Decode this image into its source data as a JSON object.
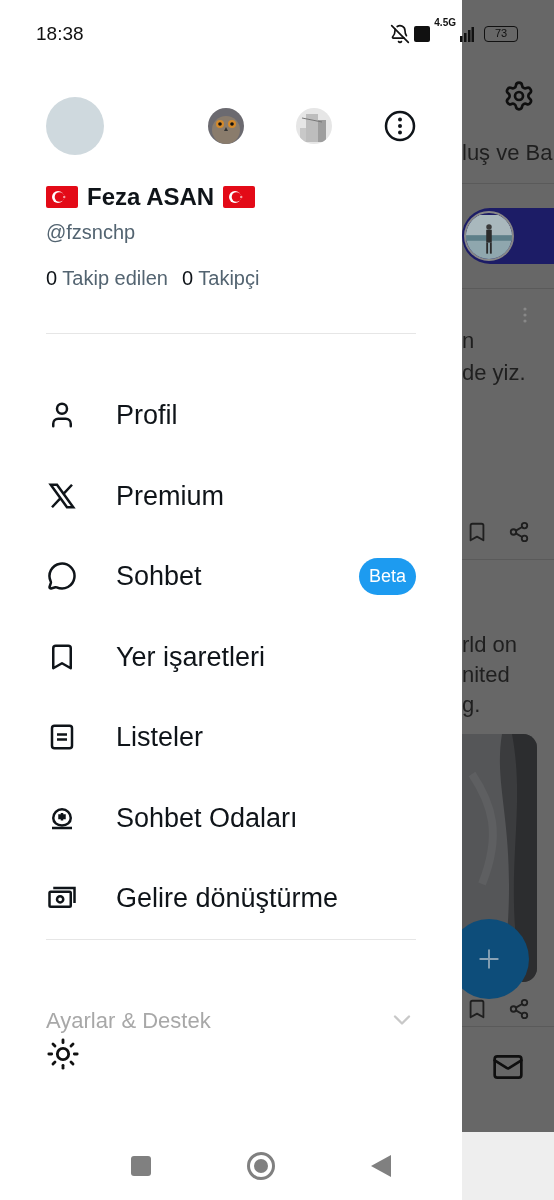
{
  "status_bar": {
    "time": "18:38",
    "network": "4.5G",
    "battery": "73"
  },
  "drawer": {
    "name": "Feza ASAN",
    "handle": "@fzsnchp",
    "following_count": "0",
    "following_label": "Takip edilen",
    "followers_count": "0",
    "followers_label": "Takipçi",
    "menu": [
      {
        "label": "Profil",
        "kind": "person"
      },
      {
        "label": "Premium",
        "kind": "x"
      },
      {
        "label": "Sohbet",
        "kind": "chat",
        "badge": "Beta"
      },
      {
        "label": "Yer işaretleri",
        "kind": "bookmark"
      },
      {
        "label": "Listeler",
        "kind": "list"
      },
      {
        "label": "Sohbet Odaları",
        "kind": "spaces"
      },
      {
        "label": "Gelire dönüştürme",
        "kind": "money"
      }
    ],
    "settings_section": {
      "label": "Ayarlar & Destek"
    }
  },
  "background": {
    "tab_label": "luş ve Ba",
    "post_1_lines": [
      "n",
      "de yiz."
    ],
    "post_2_lines": [
      "rld on",
      "nited",
      "g."
    ]
  }
}
